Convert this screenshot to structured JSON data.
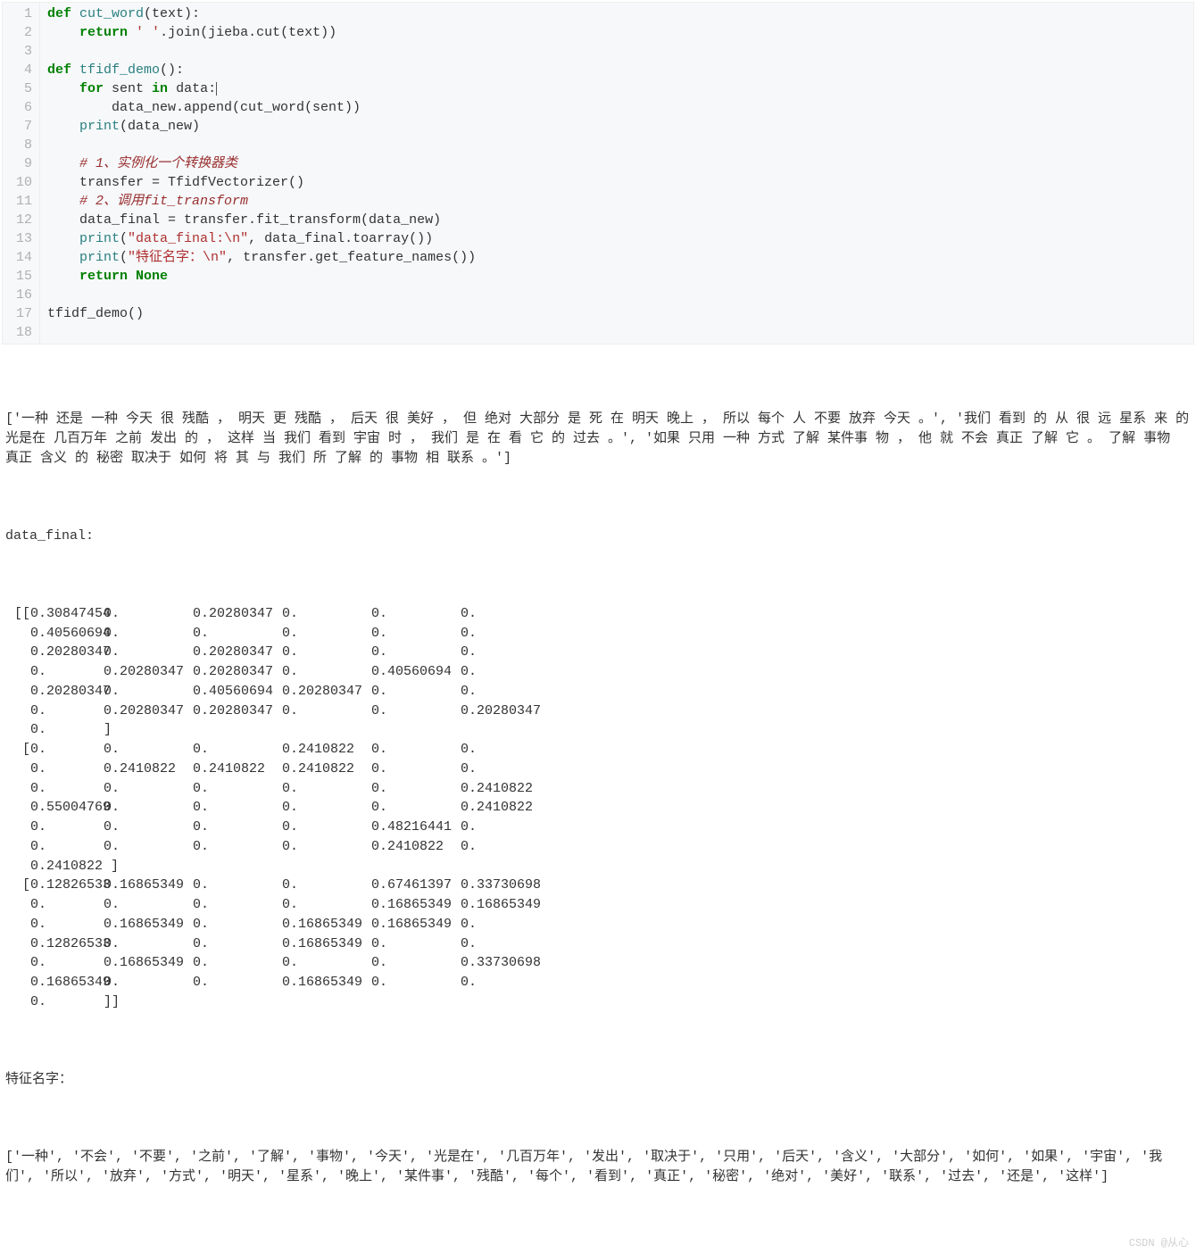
{
  "code": {
    "line_numbers": [
      "1",
      "2",
      "3",
      "4",
      "5",
      "6",
      "7",
      "8",
      "9",
      "10",
      "11",
      "12",
      "13",
      "14",
      "15",
      "16",
      "17",
      "18"
    ],
    "tokens": [
      [
        {
          "t": "def ",
          "c": "kw"
        },
        {
          "t": "cut_word",
          "c": "fn"
        },
        {
          "t": "(text):",
          "c": "id"
        }
      ],
      [
        {
          "t": "    ",
          "c": "id"
        },
        {
          "t": "return",
          "c": "kw"
        },
        {
          "t": " ",
          "c": "id"
        },
        {
          "t": "' '",
          "c": "st"
        },
        {
          "t": ".join(jieba.cut(text))",
          "c": "id"
        }
      ],
      [],
      [
        {
          "t": "def ",
          "c": "kw"
        },
        {
          "t": "tfidf_demo",
          "c": "fn"
        },
        {
          "t": "():",
          "c": "id"
        }
      ],
      [
        {
          "t": "    ",
          "c": "id"
        },
        {
          "t": "for",
          "c": "kw"
        },
        {
          "t": " sent ",
          "c": "id"
        },
        {
          "t": "in",
          "c": "kw"
        },
        {
          "t": " data:",
          "c": "id"
        }
      ],
      [
        {
          "t": "        data_new.append(cut_word(sent))",
          "c": "id"
        }
      ],
      [
        {
          "t": "    ",
          "c": "id"
        },
        {
          "t": "print",
          "c": "fn"
        },
        {
          "t": "(data_new)",
          "c": "id"
        }
      ],
      [],
      [
        {
          "t": "    ",
          "c": "id"
        },
        {
          "t": "# 1、实例化一个转换器类",
          "c": "cm"
        }
      ],
      [
        {
          "t": "    transfer = TfidfVectorizer()",
          "c": "id"
        }
      ],
      [
        {
          "t": "    ",
          "c": "id"
        },
        {
          "t": "# 2、调用fit_transform",
          "c": "cm"
        }
      ],
      [
        {
          "t": "    data_final = transfer.fit_transform(data_new)",
          "c": "id"
        }
      ],
      [
        {
          "t": "    ",
          "c": "id"
        },
        {
          "t": "print",
          "c": "fn"
        },
        {
          "t": "(",
          "c": "id"
        },
        {
          "t": "\"data_final:\\n\"",
          "c": "st"
        },
        {
          "t": ", data_final.toarray())",
          "c": "id"
        }
      ],
      [
        {
          "t": "    ",
          "c": "id"
        },
        {
          "t": "print",
          "c": "fn"
        },
        {
          "t": "(",
          "c": "id"
        },
        {
          "t": "\"特征名字：\\n\"",
          "c": "st"
        },
        {
          "t": ", transfer.get_feature_names())",
          "c": "id"
        }
      ],
      [
        {
          "t": "    ",
          "c": "id"
        },
        {
          "t": "return None",
          "c": "kw"
        }
      ],
      [],
      [
        {
          "t": "tfidf_demo()",
          "c": "id"
        }
      ],
      []
    ],
    "caret_line": 5
  },
  "output": {
    "sentences_prefix": "[",
    "sentences": [
      "'一种 还是 一种 今天 很 残酷 ， 明天 更 残酷 ， 后天 很 美好 ， 但 绝对 大部分 是 死 在 明天 晚上 ， 所以 每个 人 不要 放弃 今天 。'",
      "'我们 看到 的 从 很 远 星系 来 的 光是在 几百万年 之前 发出 的 ， 这样 当 我们 看到 宇宙 时 ， 我们 是 在 看 它 的 过去 。'",
      "'如果 只用 一种 方式 了解 某件事 物 ， 他 就 不会 真正 了解 它 。 了解 事物 真正 含义 的 秘密 取决于 如何 将 其 与 我们 所 了解 的 事物 相 联系 。'"
    ],
    "sentences_suffix": "]",
    "label_data_final": "data_final:",
    "matrix": [
      [
        "[[0.30847454",
        "0.",
        "0.20280347",
        "0.",
        "0.",
        "0."
      ],
      [
        "  0.40560694",
        "0.",
        "0.",
        "0.",
        "0.",
        "0."
      ],
      [
        "  0.20280347",
        "0.",
        "0.20280347",
        "0.",
        "0.",
        "0."
      ],
      [
        "  0.",
        "0.20280347",
        "0.20280347",
        "0.",
        "0.40560694",
        "0."
      ],
      [
        "  0.20280347",
        "0.",
        "0.40560694",
        "0.20280347",
        "0.",
        "0."
      ],
      [
        "  0.",
        "0.20280347",
        "0.20280347",
        "0.",
        "0.",
        "0.20280347"
      ],
      [
        "  0.",
        "]",
        "",
        "",
        "",
        ""
      ],
      [
        " [0.",
        "0.",
        "0.",
        "0.2410822",
        "0.",
        "0."
      ],
      [
        "  0.",
        "0.2410822",
        "0.2410822",
        "0.2410822",
        "0.",
        "0."
      ],
      [
        "  0.",
        "0.",
        "0.",
        "0.",
        "0.",
        "0.2410822"
      ],
      [
        "  0.55004769",
        "0.",
        "0.",
        "0.",
        "0.",
        "0.2410822"
      ],
      [
        "  0.",
        "0.",
        "0.",
        "0.",
        "0.48216441",
        "0."
      ],
      [
        "  0.",
        "0.",
        "0.",
        "0.",
        "0.2410822",
        "0."
      ],
      [
        "  0.2410822 ]",
        "",
        "",
        "",
        "",
        ""
      ],
      [
        " [0.12826533",
        "0.16865349",
        "0.",
        "0.",
        "0.67461397",
        "0.33730698"
      ],
      [
        "  0.",
        "0.",
        "0.",
        "0.",
        "0.16865349",
        "0.16865349"
      ],
      [
        "  0.",
        "0.16865349",
        "0.",
        "0.16865349",
        "0.16865349",
        "0."
      ],
      [
        "  0.12826533",
        "0.",
        "0.",
        "0.16865349",
        "0.",
        "0."
      ],
      [
        "  0.",
        "0.16865349",
        "0.",
        "0.",
        "0.",
        "0.33730698"
      ],
      [
        "  0.16865349",
        "0.",
        "0.",
        "0.16865349",
        "0.",
        "0."
      ],
      [
        "  0.",
        "]]",
        "",
        "",
        "",
        ""
      ]
    ],
    "label_features": "特征名字：",
    "features": [
      "'一种'",
      "'不会'",
      "'不要'",
      "'之前'",
      "'了解'",
      "'事物'",
      "'今天'",
      "'光是在'",
      "'几百万年'",
      "'发出'",
      "'取决于'",
      "'只用'",
      "'后天'",
      "'含义'",
      "'大部分'",
      "'如何'",
      "'如果'",
      "'宇宙'",
      "'我们'",
      "'所以'",
      "'放弃'",
      "'方式'",
      "'明天'",
      "'星系'",
      "'晚上'",
      "'某件事'",
      "'残酷'",
      "'每个'",
      "'看到'",
      "'真正'",
      "'秘密'",
      "'绝对'",
      "'美好'",
      "'联系'",
      "'过去'",
      "'还是'",
      "'这样'"
    ]
  },
  "watermark": "CSDN @从心"
}
